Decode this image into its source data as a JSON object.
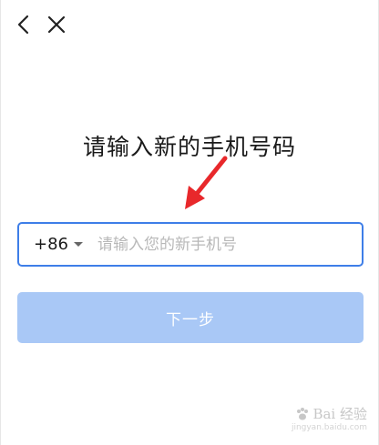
{
  "nav": {
    "back_icon": "chevron-left-icon",
    "close_icon": "close-icon"
  },
  "page": {
    "title": "请输入新的手机号码"
  },
  "phone_form": {
    "country_code": "+86",
    "phone_value": "",
    "phone_placeholder": "请输入您的新手机号",
    "next_label": "下一步"
  },
  "colors": {
    "accent": "#3e7ee8",
    "button_disabled": "#a9c8f6",
    "annotation_arrow": "#e8282b"
  },
  "watermark": {
    "brand": "Bai 经验",
    "url": "jingyan.baidu.com"
  }
}
